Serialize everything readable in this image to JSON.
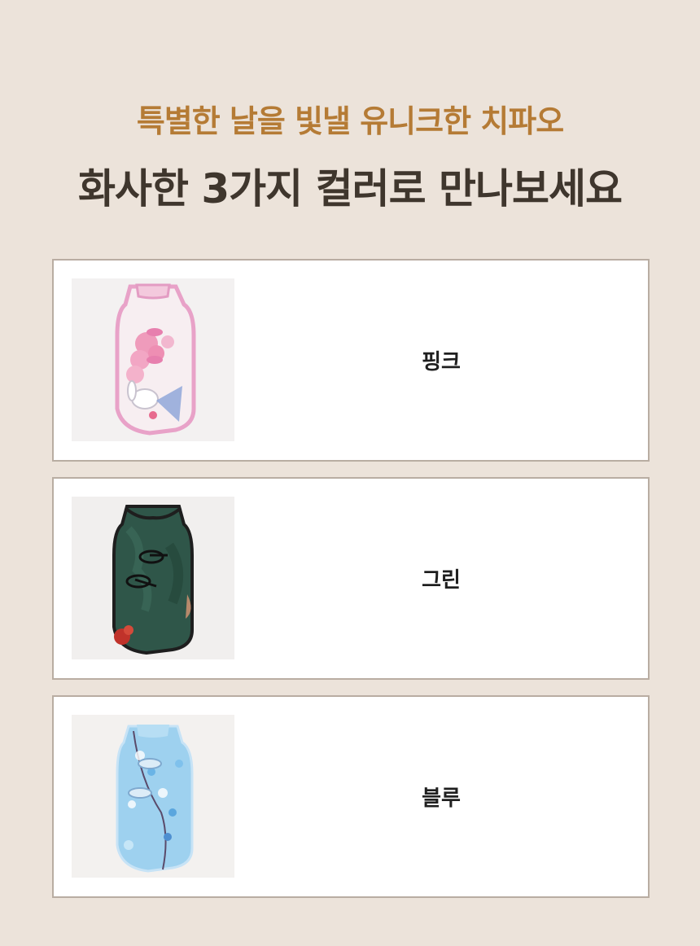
{
  "header": {
    "subtitle": "특별한 날을 빛낼 유니크한 치파오",
    "title": "화사한 3가지 컬러로 만나보세요"
  },
  "options": [
    {
      "label": "핑크",
      "icon": "pink-qipao-image"
    },
    {
      "label": "그린",
      "icon": "green-qipao-image"
    },
    {
      "label": "블루",
      "icon": "blue-qipao-image"
    }
  ],
  "colors": {
    "background": "#ece3da",
    "subtitle": "#b57b35",
    "title": "#3f362d",
    "card_border": "#b9ada2"
  }
}
